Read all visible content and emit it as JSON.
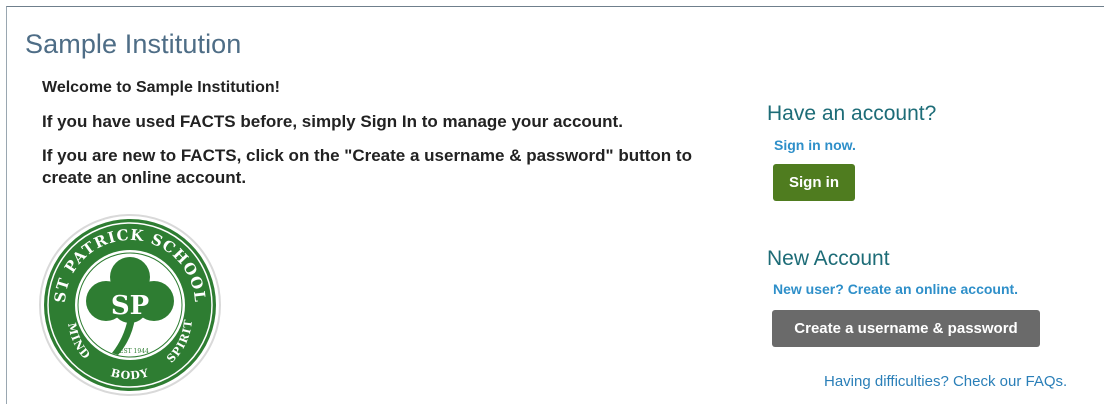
{
  "page": {
    "title": "Sample Institution"
  },
  "welcome": {
    "line1": "Welcome to Sample Institution!",
    "line2": "If you have used FACTS before, simply Sign In to manage your account.",
    "line3": "If you are new to FACTS, click on the \"Create a username & password\" button to create an online account."
  },
  "logo": {
    "name_text": "ST PATRICK SCHOOL",
    "monogram": "SP",
    "motto_left": "MIND",
    "motto_bottom": "BODY",
    "motto_right": "SPIRIT",
    "established": "EST 1944",
    "brand_color": "#2e7d32"
  },
  "existing": {
    "heading": "Have an account?",
    "link": "Sign in now.",
    "button": "Sign in",
    "button_color": "#4f7c1f"
  },
  "new_account": {
    "heading": "New Account",
    "link": "New user? Create an online account.",
    "button": "Create a username & password",
    "button_color": "#6a6a6a"
  },
  "help": {
    "faq_link": "Having difficulties? Check our FAQs."
  }
}
